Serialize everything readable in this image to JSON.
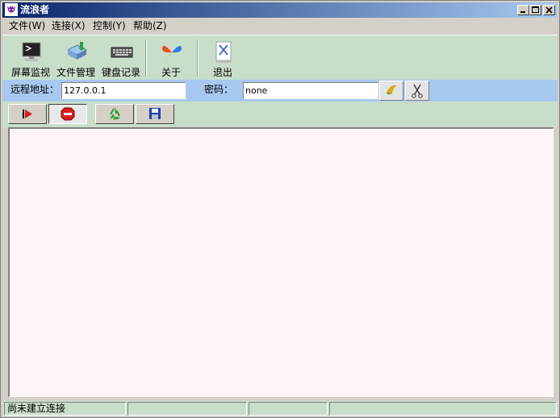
{
  "window": {
    "title": "流浪者"
  },
  "menu": {
    "items": [
      "文件(W)",
      "连接(X)",
      "控制(Y)",
      "帮助(Z)"
    ]
  },
  "toolbar": {
    "items": [
      {
        "label": "屏幕监视",
        "icon": "monitor-icon"
      },
      {
        "label": "文件管理",
        "icon": "file-manager-icon"
      },
      {
        "label": "键盘记录",
        "icon": "keyboard-icon"
      },
      {
        "label": "关于",
        "icon": "butterfly-icon"
      },
      {
        "label": "退出",
        "icon": "exit-icon"
      }
    ]
  },
  "connection": {
    "address_label": "远程地址：",
    "address_value": "127.0.0.1",
    "password_label": "密码：",
    "password_value": "none"
  },
  "status": {
    "text": "尚未建立连接"
  },
  "colors": {
    "toolbar_bg": "#c9dec9",
    "address_bg": "#a8c8f0",
    "content_bg": "#fff5f5",
    "title_start": "#0a246a",
    "title_end": "#a6caf0"
  }
}
